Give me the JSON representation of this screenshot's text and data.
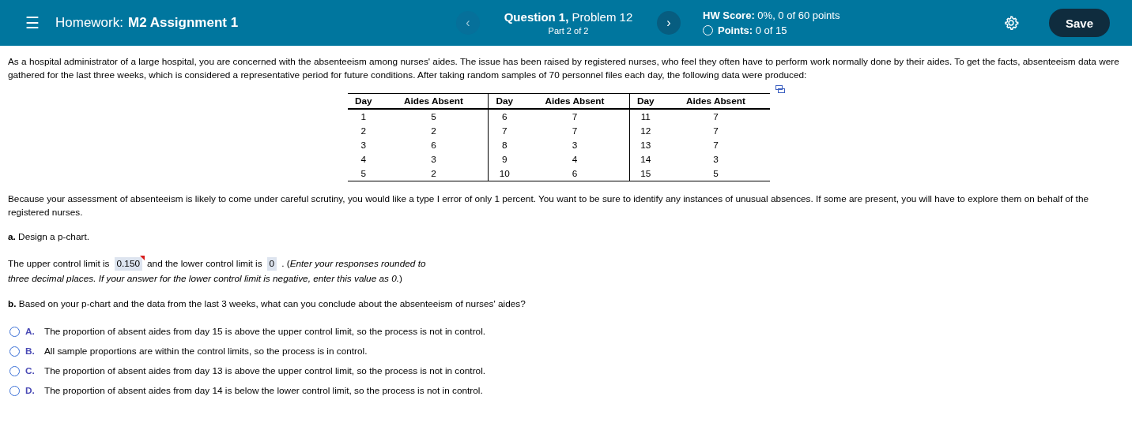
{
  "header": {
    "menu_icon": "☰",
    "homework_label": "Homework:",
    "homework_title": "M2 Assignment 1",
    "prev": "‹",
    "question": "Question 1,",
    "problem": "Problem 12",
    "part": "Part 2 of 2",
    "next": "›",
    "score_label": "HW Score:",
    "score": "0%, 0 of 60 points",
    "points_label": "Points:",
    "points": "0 of 15",
    "save": "Save"
  },
  "intro": "As a hospital administrator of a large hospital, you are concerned with the absenteeism among nurses' aides. The issue has been raised by registered nurses, who feel they often have to perform work normally done by their aides. To get the facts, absenteeism data were gathered for the last three weeks, which is considered a representative period for future conditions. After taking random samples of 70 personnel files each day, the following data were produced:",
  "table": {
    "columns": [
      "Day",
      "Aides Absent",
      "Day",
      "Aides Absent",
      "Day",
      "Aides Absent"
    ],
    "rows": [
      [
        "1",
        "5",
        "6",
        "7",
        "11",
        "7"
      ],
      [
        "2",
        "2",
        "7",
        "7",
        "12",
        "7"
      ],
      [
        "3",
        "6",
        "8",
        "3",
        "13",
        "7"
      ],
      [
        "4",
        "3",
        "9",
        "4",
        "14",
        "3"
      ],
      [
        "5",
        "2",
        "10",
        "6",
        "15",
        "5"
      ]
    ]
  },
  "context": "Because your assessment of absenteeism is likely to come under careful scrutiny, you would like a type I error of only 1 percent. You want to be sure to identify any instances of unusual absences. If some are present, you will have to explore them on behalf of the registered nurses.",
  "part_a": "**a.** Design a p-chart.",
  "answer_parts": [
    {
      "kind": "text",
      "text": "The upper control limit is"
    },
    {
      "kind": "field",
      "value": "0.150",
      "flagged": true
    },
    {
      "kind": "text",
      "text": "and the lower control limit is"
    },
    {
      "kind": "field",
      "value": "0",
      "flagged": false
    },
    {
      "kind": "text",
      "text": ". (*Enter your responses rounded to*"
    },
    {
      "kind": "text",
      "text": "*three decimal places. If your answer for the lower control limit is negative, enter this value as 0.*)"
    }
  ],
  "part_b": "**b.** Based on your p-chart and the data from the last 3 weeks, what can you conclude about the absenteeism of nurses' aides?",
  "options": [
    {
      "letter": "A.",
      "text": "The proportion of absent aides from day 15 is above the upper control limit, so the process is not in control.",
      "selected": false
    },
    {
      "letter": "B.",
      "text": "All sample proportions are within the control limits, so the process is in control.",
      "selected": false
    },
    {
      "letter": "C.",
      "text": "The proportion of absent aides from day 13 is above the upper control limit, so the process is not in control.",
      "selected": false
    },
    {
      "letter": "D.",
      "text": "The proportion of absent aides from day 14 is below the lower control limit, so the process is not in control.",
      "selected": false
    }
  ]
}
